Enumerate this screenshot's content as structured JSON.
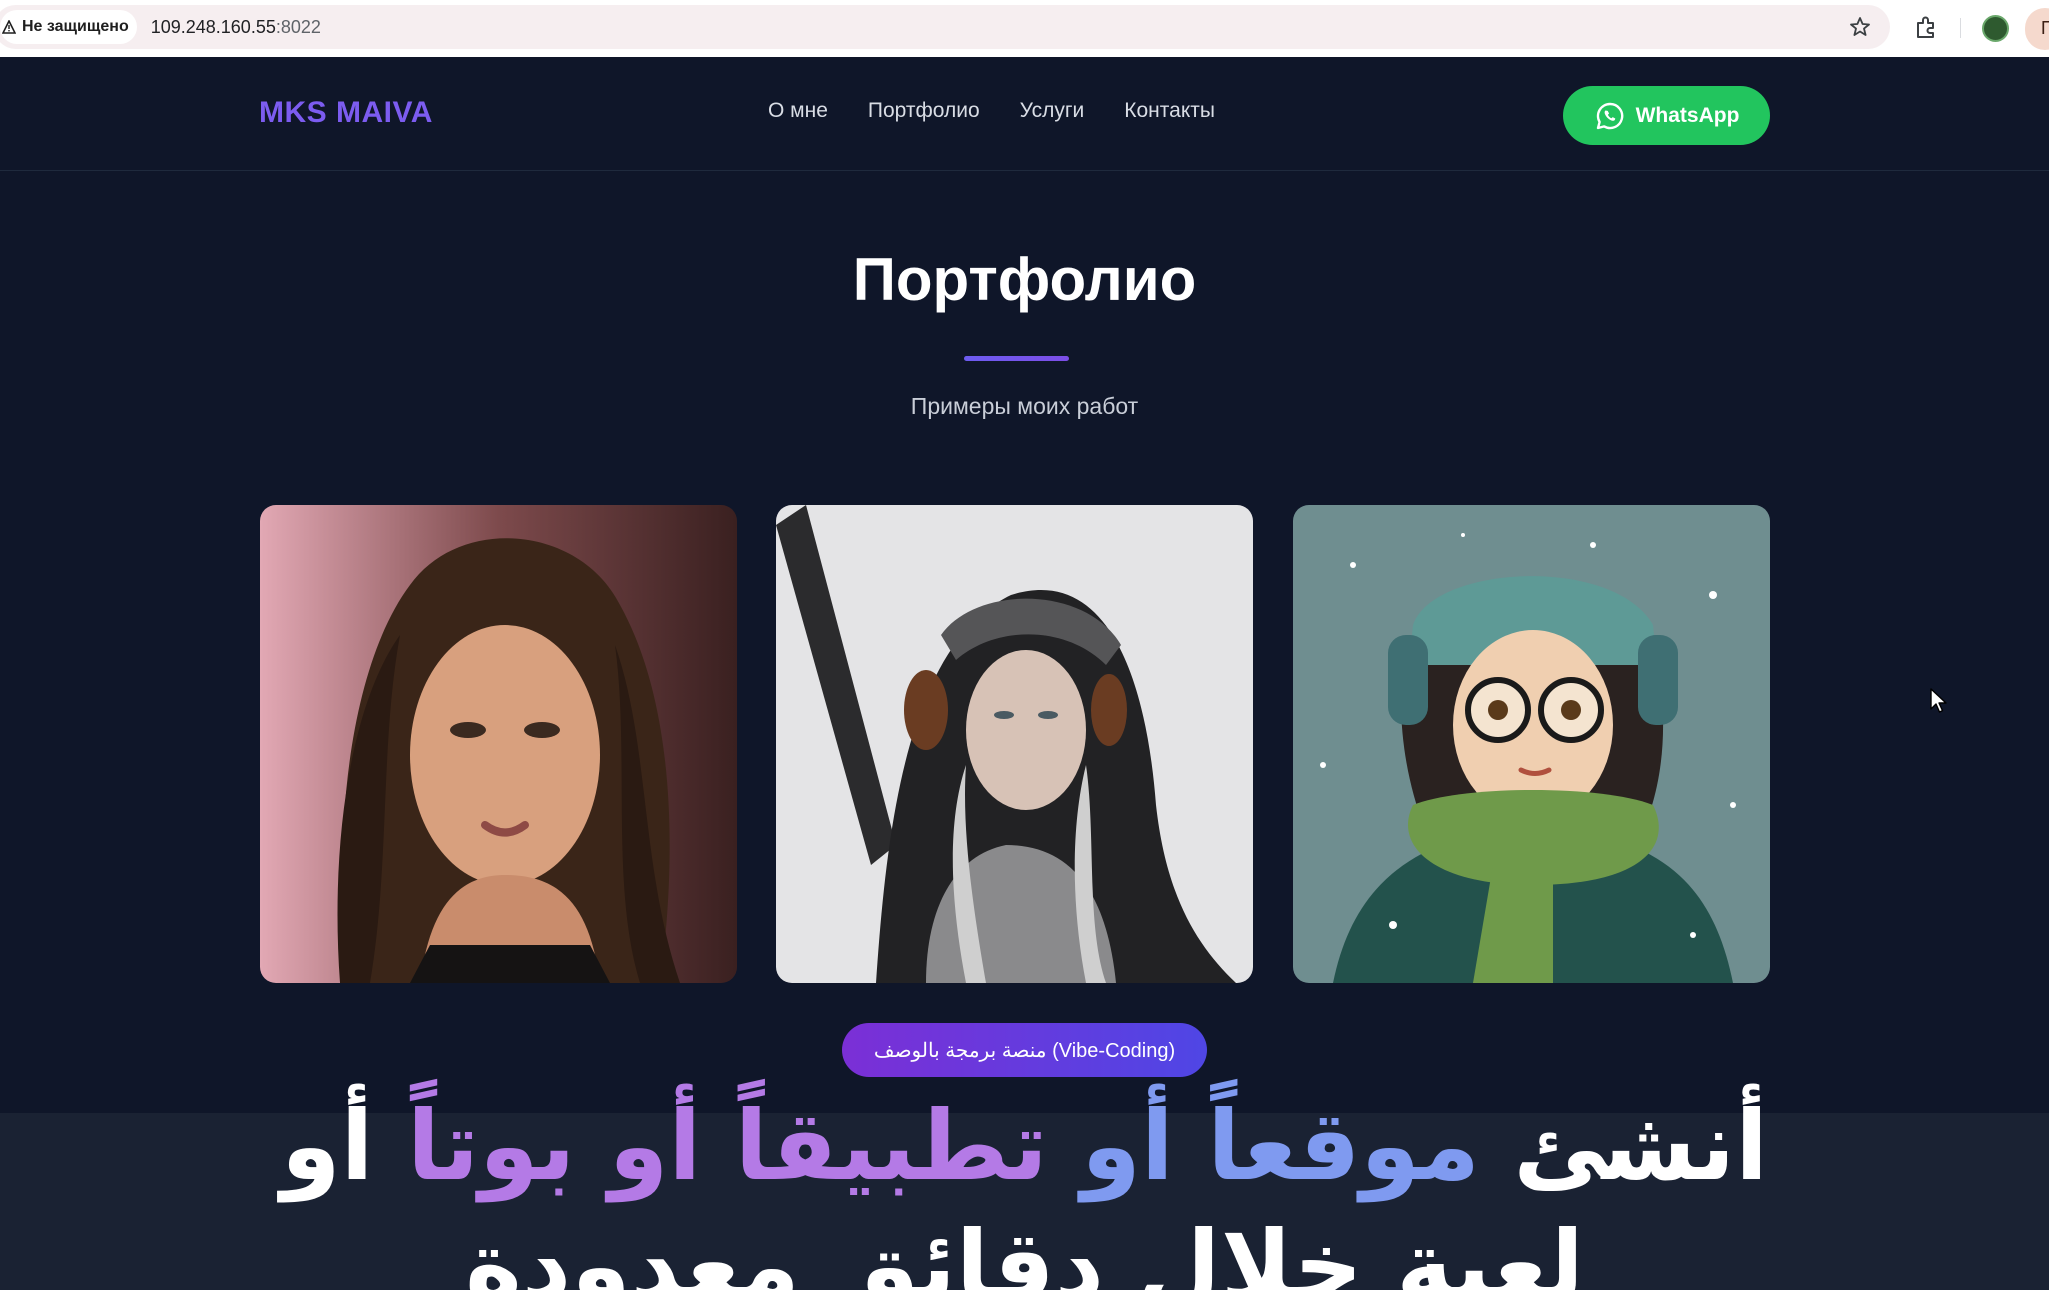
{
  "browser": {
    "security_label": "Не защищено",
    "url_host": "109.248.160.55",
    "url_port": ":8022",
    "profile_initial": "П"
  },
  "header": {
    "logo": "MKS MAIVA",
    "nav": [
      "О мне",
      "Портфолио",
      "Услуги",
      "Контакты"
    ],
    "whatsapp_label": "WhatsApp"
  },
  "portfolio": {
    "title": "Портфолио",
    "subtitle": "Примеры моих работ",
    "items": [
      "portrait-photo",
      "winter-hood-photo",
      "winter-illustration"
    ]
  },
  "overlay": {
    "promo_pill": "منصة برمجة بالوصف (Vibe-Coding)",
    "caption_line1_white": "أنشئ",
    "caption_line1_blue": "موقعاً أو",
    "caption_line1_purple": "تطبيقاً أو بوتاً",
    "caption_line1_end": "أو",
    "caption_line2": "لعبة خلال دقائق معدودة"
  },
  "colors": {
    "page_bg": "#0f1629",
    "accent": "#7c5cf0",
    "whatsapp": "#22c55e"
  }
}
